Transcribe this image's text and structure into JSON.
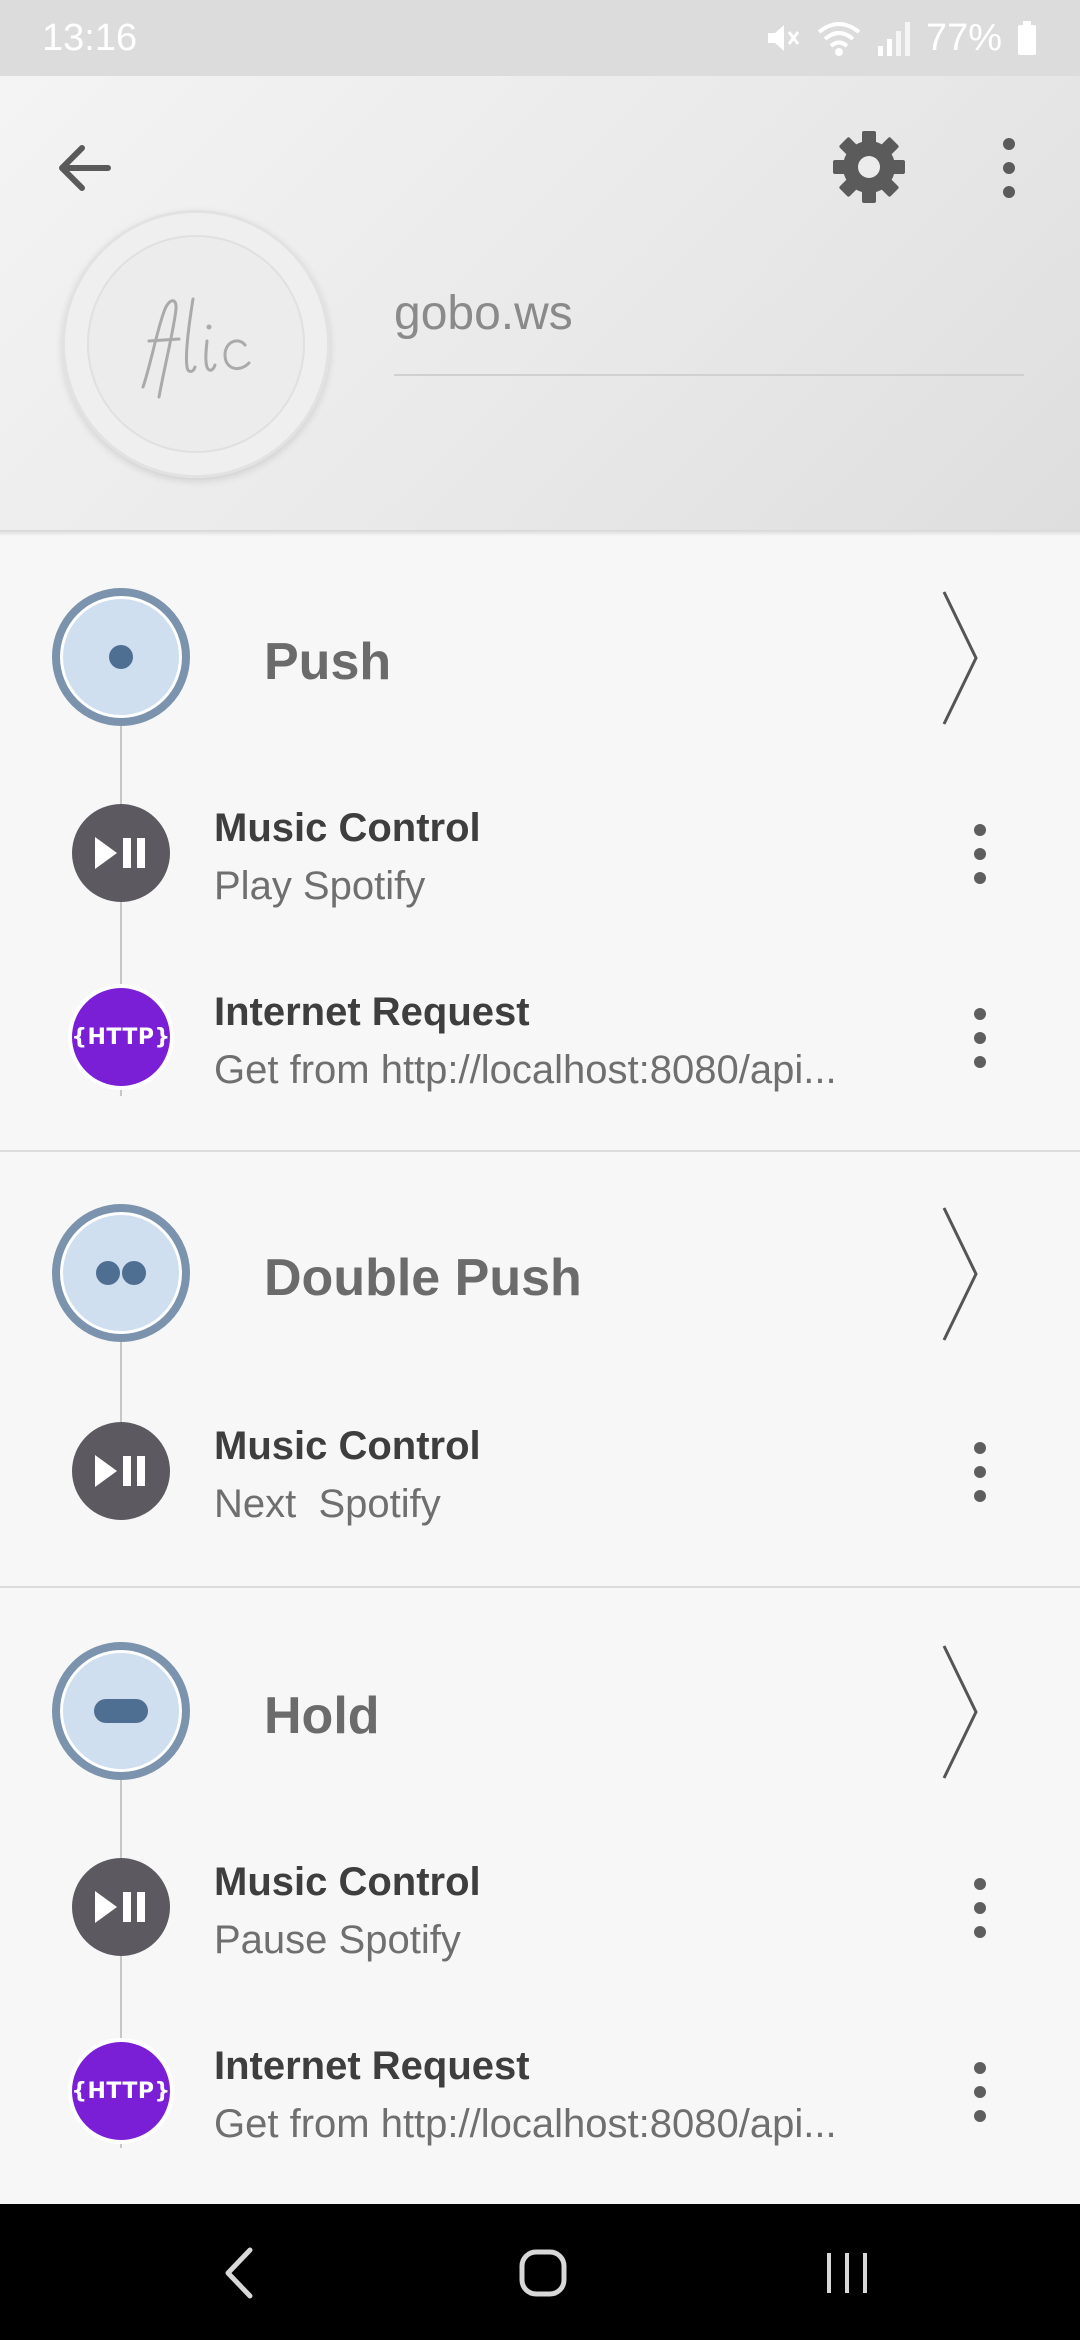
{
  "status_bar": {
    "time": "13:16",
    "battery": "77%",
    "icons": [
      "mute-icon",
      "wifi-icon",
      "signal-icon",
      "battery-icon"
    ]
  },
  "header": {
    "logo_text": "flic",
    "device_name": "gobo.ws",
    "icons": [
      "arrow-back-icon",
      "gear-icon",
      "more-vert-icon"
    ]
  },
  "triggers": [
    {
      "label": "Push",
      "actions": [
        {
          "type": "music",
          "title": "Music Control",
          "subtitle": "Play Spotify"
        },
        {
          "type": "http",
          "icon_text": "{HTTP}",
          "title": "Internet Request",
          "subtitle": "Get from http://localhost:8080/api..."
        }
      ]
    },
    {
      "label": "Double Push",
      "actions": [
        {
          "type": "music",
          "title": "Music Control",
          "subtitle": "Next  Spotify"
        }
      ]
    },
    {
      "label": "Hold",
      "actions": [
        {
          "type": "music",
          "title": "Music Control",
          "subtitle": "Pause Spotify"
        },
        {
          "type": "http",
          "icon_text": "{HTTP}",
          "title": "Internet Request",
          "subtitle": "Get from http://localhost:8080/api..."
        }
      ]
    }
  ],
  "colors": {
    "trigger_fill": "#cfdff0",
    "trigger_ring": "#7b93ac",
    "music_icon_bg": "#5c5a60",
    "http_icon_bg": "#7a1fd6",
    "nav_bar_bg": "#000000"
  },
  "nav_bar": {
    "icons": [
      "back-nav-icon",
      "home-nav-icon",
      "recents-nav-icon"
    ]
  }
}
